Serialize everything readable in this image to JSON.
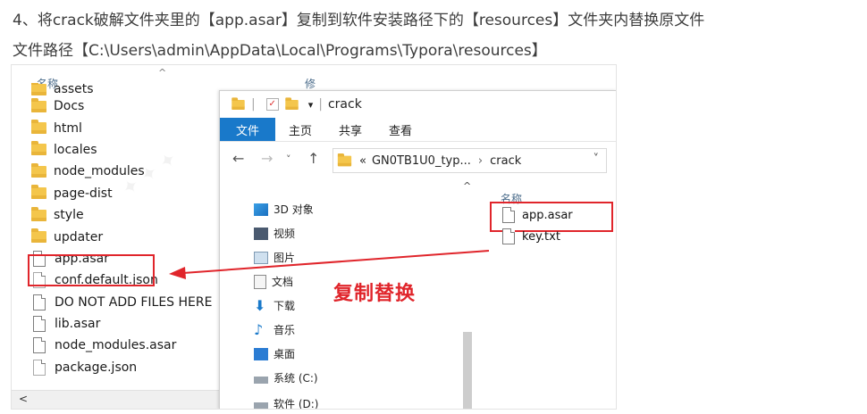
{
  "instructions": {
    "line1": "4、将crack破解文件夹里的【app.asar】复制到软件安装路径下的【resources】文件夹内替换原文件",
    "line2": "文件路径【C:\\Users\\admin\\AppData\\Local\\Programs\\Typora\\resources】"
  },
  "bg_explorer": {
    "col_name": "名称",
    "col_modified": "修",
    "items": [
      {
        "label": "assets",
        "type": "folder"
      },
      {
        "label": "Docs",
        "type": "folder"
      },
      {
        "label": "html",
        "type": "folder"
      },
      {
        "label": "locales",
        "type": "folder"
      },
      {
        "label": "node_modules",
        "type": "folder"
      },
      {
        "label": "page-dist",
        "type": "folder"
      },
      {
        "label": "style",
        "type": "folder"
      },
      {
        "label": "updater",
        "type": "folder"
      },
      {
        "label": "app.asar",
        "type": "file"
      },
      {
        "label": "conf.default.json",
        "type": "json"
      },
      {
        "label": "DO NOT ADD FILES HERE",
        "type": "file"
      },
      {
        "label": "lib.asar",
        "type": "file"
      },
      {
        "label": "node_modules.asar",
        "type": "file"
      },
      {
        "label": "package.json",
        "type": "json"
      }
    ],
    "scroll_left": "<"
  },
  "crack_window": {
    "title": "crack",
    "ribbon_tabs": [
      "文件",
      "主页",
      "共享",
      "查看"
    ],
    "address": {
      "prefix": "«",
      "path_part": "GN0TB1U0_typ...",
      "current": "crack"
    },
    "nav_items": [
      {
        "label": "3D 对象",
        "icon": "3d-objects-icon"
      },
      {
        "label": "视频",
        "icon": "video-icon"
      },
      {
        "label": "图片",
        "icon": "pictures-icon"
      },
      {
        "label": "文档",
        "icon": "documents-icon"
      },
      {
        "label": "下载",
        "icon": "download-icon"
      },
      {
        "label": "音乐",
        "icon": "music-icon"
      },
      {
        "label": "桌面",
        "icon": "desktop-icon"
      },
      {
        "label": "系统 (C:)",
        "icon": "drive-icon"
      },
      {
        "label": "软件 (D:)",
        "icon": "drive-icon"
      }
    ],
    "content_header": "名称",
    "files": [
      "app.asar",
      "key.txt"
    ]
  },
  "callout": "复制替换",
  "colors": {
    "accent": "#1979ca",
    "highlight": "#e0252b",
    "folder": "#f4c64c"
  }
}
